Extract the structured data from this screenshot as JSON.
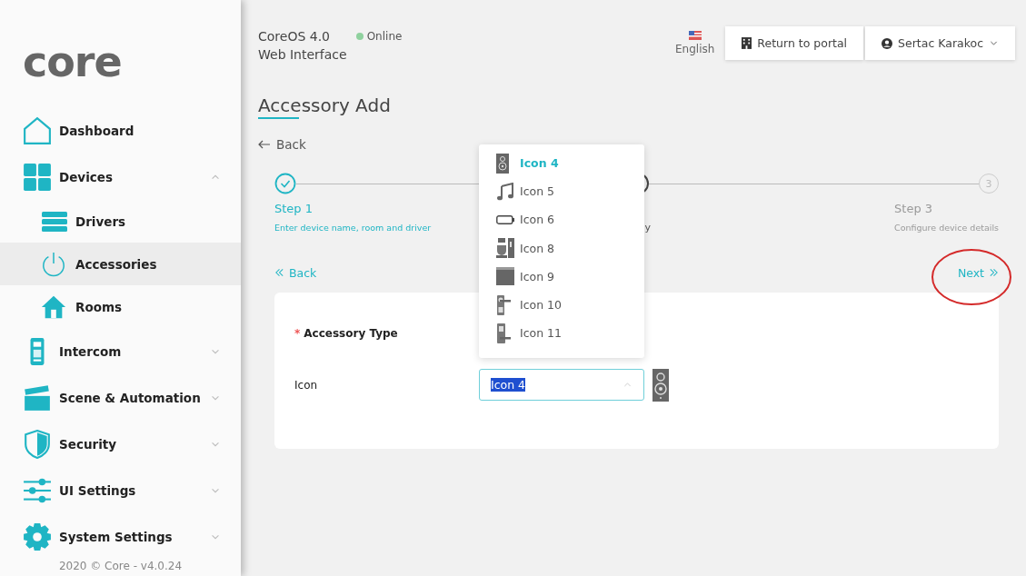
{
  "sidebar": {
    "logo": "core",
    "items": [
      {
        "label": "Dashboard",
        "selected": false
      },
      {
        "label": "Devices",
        "selected": false,
        "expanded": true,
        "children": [
          {
            "label": "Drivers",
            "selected": false
          },
          {
            "label": "Accessories",
            "selected": true
          },
          {
            "label": "Rooms",
            "selected": false
          }
        ]
      },
      {
        "label": "Intercom",
        "selected": false,
        "expanded": false
      },
      {
        "label": "Scene & Automation",
        "selected": false,
        "expanded": false
      },
      {
        "label": "Security",
        "selected": false,
        "expanded": false
      },
      {
        "label": "UI Settings",
        "selected": false,
        "expanded": false
      },
      {
        "label": "System Settings",
        "selected": false,
        "expanded": false
      }
    ],
    "footer": "2020 © Core - v4.0.24"
  },
  "header": {
    "product": "CoreOS 4.0",
    "subtitle": "Web Interface",
    "status": "Online",
    "language": "English",
    "portal_button": "Return to portal",
    "user": "Sertac Karakoc"
  },
  "page": {
    "title": "Accessory Add",
    "back": "Back"
  },
  "steps": [
    {
      "completed": true,
      "active": false,
      "title": "Step 1",
      "description": "Enter device name, room and driver"
    },
    {
      "completed": false,
      "active": true,
      "description": "y"
    },
    {
      "completed": false,
      "active": false,
      "number": "3",
      "title": "Step 3",
      "description": "Configure device details"
    }
  ],
  "nav": {
    "back": "Back",
    "next": "Next"
  },
  "form": {
    "fields": [
      {
        "kind": "select",
        "label": "Accessory Type",
        "required_mark": "*"
      },
      {
        "kind": "icon-select",
        "label": "Icon",
        "value": "Icon 4",
        "text_selected": true,
        "open": true
      }
    ]
  },
  "dropdown": [
    {
      "label": "Icon 4",
      "selected": true
    },
    {
      "label": "Icon 5",
      "selected": false
    },
    {
      "label": "Icon 6",
      "selected": false
    },
    {
      "label": "Icon 8",
      "selected": false
    },
    {
      "label": "Icon 9",
      "selected": false
    },
    {
      "label": "Icon 10",
      "selected": false
    },
    {
      "label": "Icon 11",
      "selected": false
    }
  ]
}
